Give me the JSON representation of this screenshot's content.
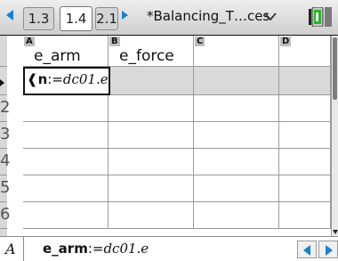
{
  "tabs": [
    {
      "label": "1.3",
      "active": false
    },
    {
      "label": "1.4",
      "active": true
    },
    {
      "label": "2.1",
      "active": false
    }
  ],
  "document_title": "*Balancing_T…ces",
  "columns": [
    {
      "letter": "A",
      "name": "e_arm"
    },
    {
      "letter": "B",
      "name": "e_force"
    },
    {
      "letter": "C",
      "name": ""
    },
    {
      "letter": "D",
      "name": ""
    }
  ],
  "formula_cell": {
    "prefix": "❰n",
    "assign": ":=",
    "expr": "dc01.e"
  },
  "row_numbers": [
    "2",
    "3",
    "4",
    "5",
    "6"
  ],
  "entry_line": {
    "label": "A",
    "var": "e_arm",
    "assign": ":=",
    "expr": "dc01.e"
  },
  "colors": {
    "accent": "#1a7fd0",
    "header_gray": "#bdbdbd",
    "formula_row": "#d9d9d9"
  },
  "icons": {
    "tab_prev": "left-triangle-icon",
    "tab_next": "right-triangle-icon",
    "document_menu": "chevron-down-icon",
    "battery": "battery-icon"
  }
}
